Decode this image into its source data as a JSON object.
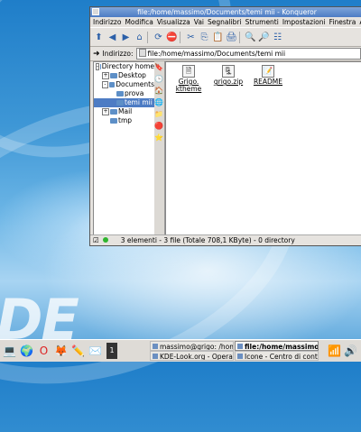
{
  "desktop": {
    "logo_text": "DE"
  },
  "window": {
    "title": "file:/home/massimo/Documents/temi mii - Konqueror",
    "menu": [
      "Indirizzo",
      "Modifica",
      "Visualizza",
      "Vai",
      "Segnalibri",
      "Strumenti",
      "Impostazioni",
      "Finestra",
      "Aiuto"
    ],
    "toolbar_icons": [
      "up-arrow-icon",
      "back-arrow-icon",
      "forward-arrow-icon",
      "home-icon",
      "reload-icon",
      "stop-icon",
      "cut-icon",
      "copy-icon",
      "paste-icon",
      "print-icon",
      "zoom-in-icon",
      "zoom-out-icon",
      "view-mode-icon"
    ],
    "location": {
      "label": "Indirizzo:",
      "value": "file:/home/massimo/Documents/temi mii"
    },
    "tree": [
      {
        "label": "Directory home",
        "level": 0,
        "exp": "-"
      },
      {
        "label": "Desktop",
        "level": 1,
        "exp": "+"
      },
      {
        "label": "Documents",
        "level": 1,
        "exp": "-"
      },
      {
        "label": "prova",
        "level": 2,
        "exp": ""
      },
      {
        "label": "temi mii",
        "level": 2,
        "exp": "",
        "selected": true
      },
      {
        "label": "Mail",
        "level": 1,
        "exp": "+"
      },
      {
        "label": "tmp",
        "level": 1,
        "exp": ""
      }
    ],
    "files": [
      {
        "name": "Grigo.\nktheme",
        "icon": "document-icon"
      },
      {
        "name": "grigo.zip",
        "icon": "archive-icon"
      },
      {
        "name": "README",
        "icon": "readme-icon"
      }
    ],
    "status": "3 elementi - 3 file (Totale 708,1 KByte) - 0 directory"
  },
  "taskbar": {
    "tasks": [
      {
        "label": "massimo@grigo: /hom",
        "active": false
      },
      {
        "label": "KDE-Look.org - Opera",
        "active": false
      },
      {
        "label": "file:/home/massimo/Do",
        "active": true
      },
      {
        "label": "Icone - Centro di contr",
        "active": false
      }
    ],
    "pager": "1"
  }
}
